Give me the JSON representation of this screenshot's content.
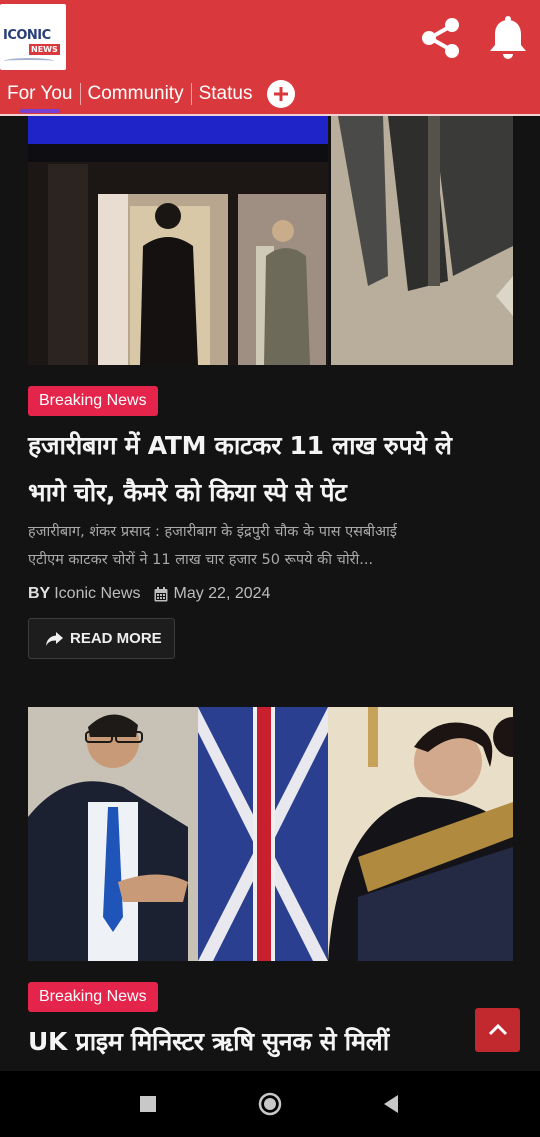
{
  "app": {
    "logo_word1": "ICONIC",
    "logo_word2": "NEWS",
    "colors": {
      "header": "#d9393d",
      "badge": "#e4244a",
      "tab_indicator": "#7b3fd0",
      "background": "#131313"
    }
  },
  "header": {
    "icons": [
      "share-icon",
      "bell-icon"
    ],
    "tabs": [
      {
        "label": "For You",
        "active": true
      },
      {
        "label": "Community",
        "active": false
      },
      {
        "label": "Status",
        "active": false
      }
    ],
    "add_tab_icon": "plus-icon"
  },
  "feed": {
    "articles": [
      {
        "image_alt": "ATM booth CCTV frame and damaged ATM",
        "category": "Breaking News",
        "title_line1": "हजारीबाग में ATM काटकर 11 लाख रुपये ले",
        "title_line2": "भागे चोर, कैमरे को किया स्पे से पेंट",
        "excerpt_line1": "हजारीबाग, शंकर प्रसाद : हजारीबाग के इंद्रपुरी चौक के पास एसबीआई",
        "excerpt_line2": "एटीएम काटकर चोरों ने 11 लाख चार हजार 50 रूपये की चोरी...",
        "by_label": "BY",
        "author": "Iconic News",
        "date": "May 22, 2024",
        "read_more": "READ MORE"
      },
      {
        "image_alt": "UK Prime Minister with woman in saree",
        "category": "Breaking News",
        "title_line1": "UK प्राइम मिनिस्टर ऋषि सुनक से मिलीं"
      }
    ]
  },
  "floating": {
    "scroll_top_icon": "chevron-up-icon"
  },
  "system_nav": {
    "icons": [
      "recents-square-icon",
      "home-circle-icon",
      "back-triangle-icon"
    ]
  }
}
